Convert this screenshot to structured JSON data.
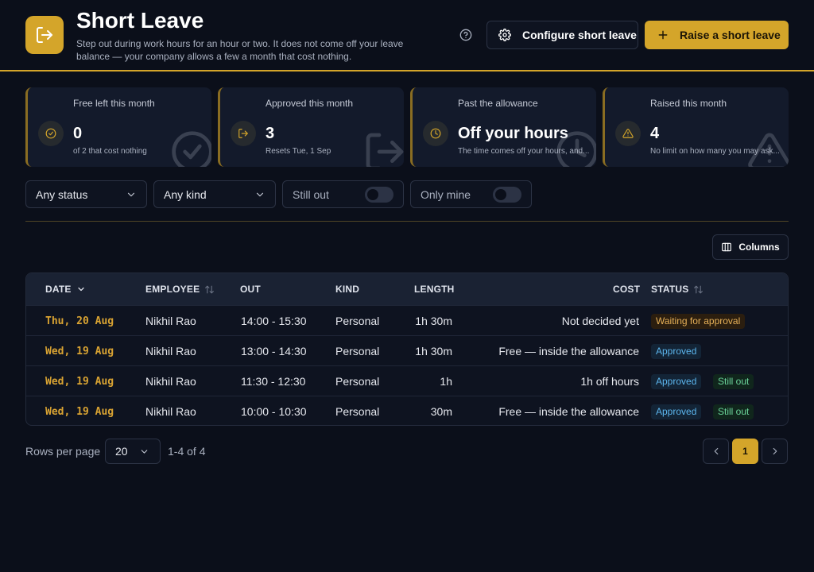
{
  "header": {
    "title": "Short Leave",
    "subtitle": "Step out during work hours for an hour or two. It does not come off your leave balance — your company allows a few a month that cost nothing.",
    "configure_label": "Configure short leave",
    "raise_label": "Raise a short leave"
  },
  "cards": [
    {
      "label": "Free left this month",
      "value": "0",
      "note": "of 2 that cost nothing",
      "icon": "check-circle-icon"
    },
    {
      "label": "Approved this month",
      "value": "3",
      "note": "Resets Tue, 1 Sep",
      "icon": "log-out-icon"
    },
    {
      "label": "Past the allowance",
      "value": "Off your hours",
      "note": "The time comes off your hours, and...",
      "icon": "clock-icon"
    },
    {
      "label": "Raised this month",
      "value": "4",
      "note": "No limit on how many you may ask...",
      "icon": "alert-triangle-icon"
    }
  ],
  "filters": {
    "status": "Any status",
    "kind": "Any kind",
    "still_out": "Still out",
    "only_mine": "Only mine"
  },
  "columns_label": "Columns",
  "table": {
    "headers": {
      "date": "DATE",
      "employee": "EMPLOYEE",
      "out": "OUT",
      "kind": "KIND",
      "length": "LENGTH",
      "cost": "COST",
      "status": "STATUS"
    },
    "rows": [
      {
        "date": "Thu, 20 Aug",
        "employee": "Nikhil Rao",
        "out": "14:00 - 15:30",
        "kind": "Personal",
        "length": "1h 30m",
        "cost": "Not decided yet",
        "status": "Waiting for approval",
        "extra": ""
      },
      {
        "date": "Wed, 19 Aug",
        "employee": "Nikhil Rao",
        "out": "13:00 - 14:30",
        "kind": "Personal",
        "length": "1h 30m",
        "cost": "Free — inside the allowance",
        "status": "Approved",
        "extra": ""
      },
      {
        "date": "Wed, 19 Aug",
        "employee": "Nikhil Rao",
        "out": "11:30 - 12:30",
        "kind": "Personal",
        "length": "1h",
        "cost": "1h off hours",
        "status": "Approved",
        "extra": "Still out"
      },
      {
        "date": "Wed, 19 Aug",
        "employee": "Nikhil Rao",
        "out": "10:00 - 10:30",
        "kind": "Personal",
        "length": "30m",
        "cost": "Free — inside the allowance",
        "status": "Approved",
        "extra": "Still out"
      }
    ]
  },
  "pagination": {
    "rows_per_page_label": "Rows per page",
    "rows_per_page": "20",
    "range": "1-4 of 4",
    "current_page": "1"
  },
  "colors": {
    "accent": "#d4a52a",
    "background": "#0b0f1a",
    "card": "#131a2b",
    "approved": "#5cb6ee",
    "waiting": "#e7b158",
    "still_out": "#6bd49a"
  }
}
